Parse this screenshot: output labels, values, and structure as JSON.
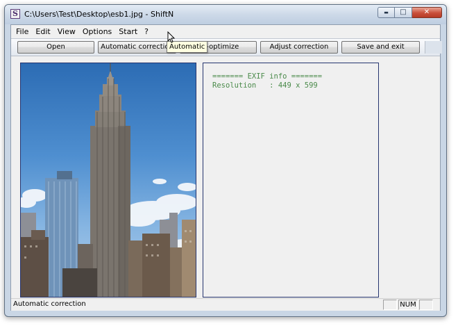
{
  "window": {
    "title": "C:\\Users\\Test\\Desktop\\esb1.jpg - ShiftN",
    "app_icon_letter": "S",
    "caption_buttons": {
      "minimize": "▬",
      "maximize": "□",
      "close": "✕"
    }
  },
  "menu": {
    "items": [
      {
        "label": "File"
      },
      {
        "label": "Edit"
      },
      {
        "label": "View"
      },
      {
        "label": "Options"
      },
      {
        "label": "Start"
      },
      {
        "label": "?"
      }
    ]
  },
  "toolbar": {
    "buttons": [
      {
        "label": "Open"
      },
      {
        "label": "Automatic correction"
      },
      {
        "label": "Re-optimize"
      },
      {
        "label": "Adjust correction"
      },
      {
        "label": "Save and exit"
      }
    ]
  },
  "tooltip": {
    "text": "Automatic"
  },
  "image_panel": {
    "subject": "photo of skyscraper (Empire State Building) against blue sky",
    "colors": {
      "sky_top": "#2c6cb4",
      "sky_bottom": "#b6d1ea",
      "buildings": "#6f6a63"
    }
  },
  "info_panel": {
    "lines": [
      "======= EXIF info =======",
      "Resolution   : 449 x 599"
    ],
    "text_color": "#4a8a4a"
  },
  "status_bar": {
    "text": "Automatic correction",
    "panes": [
      "",
      "NUM",
      ""
    ]
  }
}
